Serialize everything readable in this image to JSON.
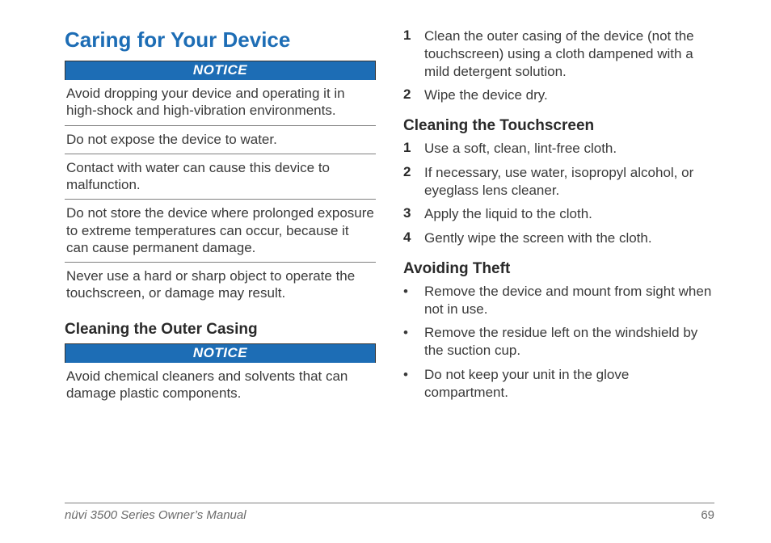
{
  "left": {
    "title": "Caring for Your Device",
    "notice1_label": "NOTICE",
    "notice1_items": [
      "Avoid dropping your device and operating it in high-shock and high-vibration environments.",
      "Do not expose the device to water.",
      "Contact with water can cause this device to malfunction.",
      "Do not store the device where prolonged exposure to extreme temperatures can occur, because it can cause permanent damage.",
      "Never use a hard or sharp object to operate the touchscreen, or damage may result."
    ],
    "sub1": "Cleaning the Outer Casing",
    "notice2_label": "NOTICE",
    "notice2_items": [
      "Avoid chemical cleaners and solvents that can damage plastic components."
    ]
  },
  "right": {
    "steps_casing": [
      "Clean the outer casing of the device (not the touchscreen) using a cloth dampened with a mild detergent solution.",
      "Wipe the device dry."
    ],
    "sub_touch": "Cleaning the Touchscreen",
    "steps_touch": [
      "Use a soft, clean, lint-free cloth.",
      "If necessary, use water, isopropyl alcohol, or eyeglass lens cleaner.",
      "Apply the liquid to the cloth.",
      "Gently wipe the screen with the cloth."
    ],
    "sub_theft": "Avoiding Theft",
    "bullets_theft": [
      "Remove the device and mount from sight when not in use.",
      "Remove the residue left on the windshield by the suction cup.",
      "Do not keep your unit in the glove compartment."
    ]
  },
  "footer": {
    "manual": "nüvi 3500 Series Owner’s Manual",
    "page": "69"
  }
}
